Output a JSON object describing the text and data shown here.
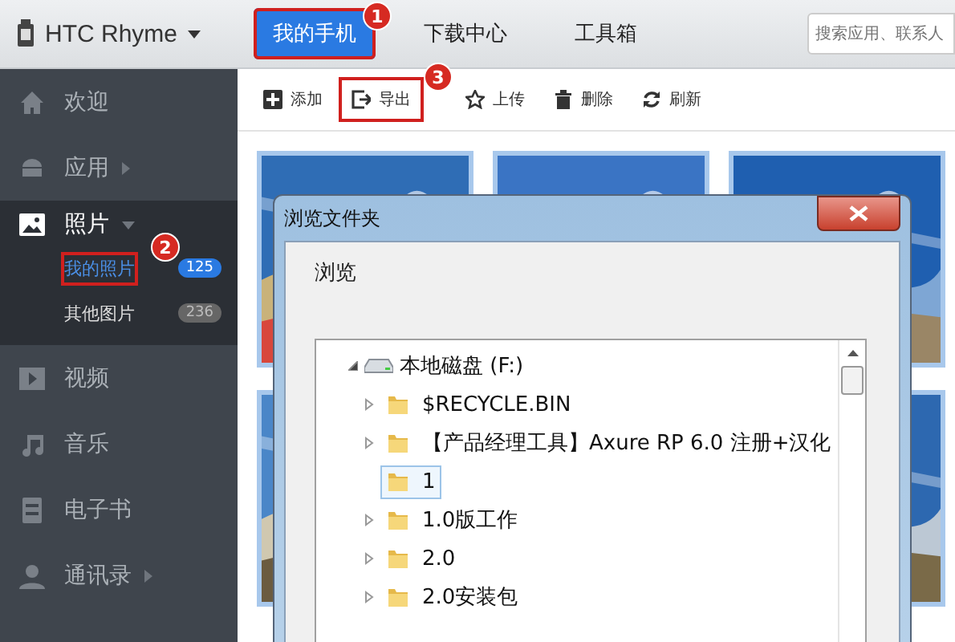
{
  "app": {
    "device": "HTC Rhyme"
  },
  "tabs": [
    {
      "label": "我的手机",
      "selected": true,
      "marker": "1"
    },
    {
      "label": "下载中心",
      "selected": false
    },
    {
      "label": "工具箱",
      "selected": false
    }
  ],
  "search": {
    "placeholder": "搜索应用、联系人"
  },
  "sidebar": {
    "items": [
      {
        "label": "欢迎",
        "expandable": false,
        "expanded": false
      },
      {
        "label": "应用",
        "expandable": true,
        "expanded": false
      },
      {
        "label": "照片",
        "expandable": true,
        "expanded": true,
        "children": [
          {
            "label": "我的照片",
            "count": "125",
            "selected": true,
            "marker": "2"
          },
          {
            "label": "其他图片",
            "count": "236",
            "selected": false
          }
        ]
      },
      {
        "label": "视频",
        "expandable": false,
        "expanded": false
      },
      {
        "label": "音乐",
        "expandable": false,
        "expanded": false
      },
      {
        "label": "电子书",
        "expandable": false,
        "expanded": false
      },
      {
        "label": "通讯录",
        "expandable": true,
        "expanded": false
      }
    ]
  },
  "toolbar": [
    {
      "label": "添加"
    },
    {
      "label": "导出",
      "marker": "3"
    },
    {
      "label": "上传"
    },
    {
      "label": "删除"
    },
    {
      "label": "刷新"
    }
  ],
  "dialog": {
    "title": "浏览文件夹",
    "prompt": "浏览",
    "tree": [
      {
        "label": "本地磁盘 (F:)",
        "kind": "drive",
        "expanded": true,
        "children": [
          {
            "label": "$RECYCLE.BIN",
            "kind": "folder",
            "expandable": true,
            "selected": false
          },
          {
            "label": "【产品经理工具】Axure RP 6.0 注册+汉化",
            "kind": "folder",
            "expandable": true,
            "selected": false
          },
          {
            "label": "1",
            "kind": "folder",
            "expandable": false,
            "selected": true
          },
          {
            "label": "1.0版工作",
            "kind": "folder",
            "expandable": true,
            "selected": false
          },
          {
            "label": "2.0",
            "kind": "folder",
            "expandable": true,
            "selected": false
          },
          {
            "label": "2.0安装包",
            "kind": "folder",
            "expandable": true,
            "selected": false
          }
        ]
      }
    ]
  }
}
